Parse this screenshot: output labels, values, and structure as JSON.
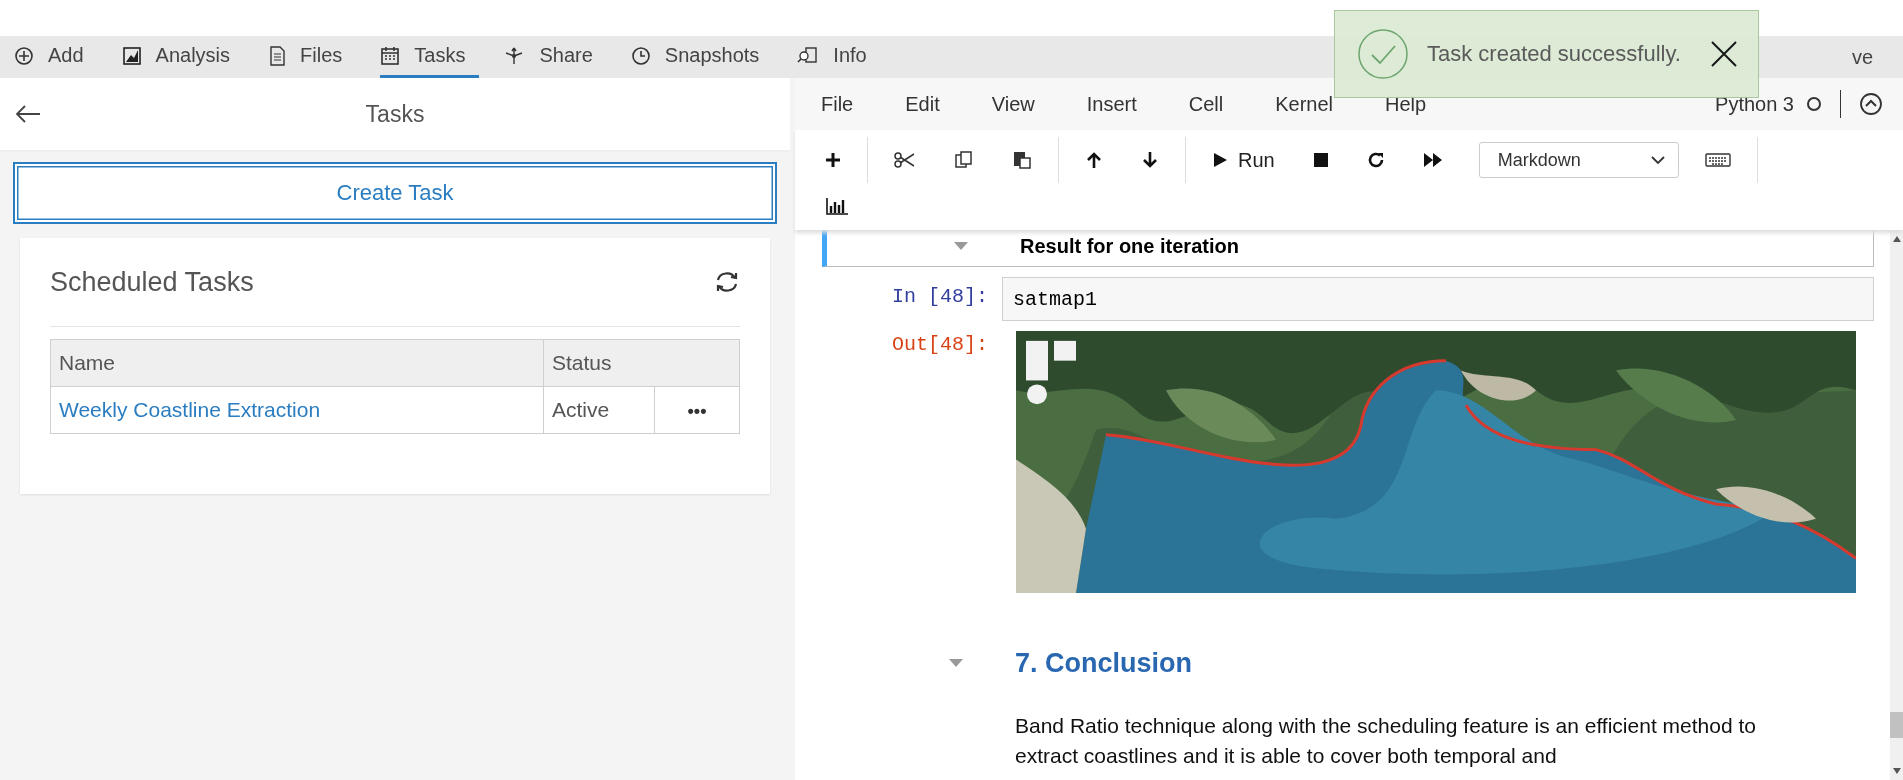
{
  "tabs": [
    {
      "label": "Add",
      "selected": false
    },
    {
      "label": "Analysis",
      "selected": false
    },
    {
      "label": "Files",
      "selected": false
    },
    {
      "label": "Tasks",
      "selected": true
    },
    {
      "label": "Share",
      "selected": false
    },
    {
      "label": "Snapshots",
      "selected": false
    },
    {
      "label": "Info",
      "selected": false
    }
  ],
  "tab_bar_end": {
    "label": "ve"
  },
  "toast": {
    "message": "Task created successfully."
  },
  "panel": {
    "title": "Tasks",
    "create_button": "Create Task",
    "card": {
      "title": "Scheduled Tasks",
      "columns": [
        "Name",
        "Status"
      ],
      "rows": [
        {
          "name": "Weekly Coastline Extraction",
          "status": "Active",
          "menu": "•••"
        }
      ]
    }
  },
  "notebook": {
    "menu": [
      "File",
      "Edit",
      "View",
      "Insert",
      "Cell",
      "Kernel",
      "Help"
    ],
    "kernel": "Python 3",
    "run_label": "Run",
    "cell_type": "Markdown",
    "cells": [
      {
        "kind": "heading",
        "text": "Result for one iteration",
        "selected": true
      },
      {
        "kind": "code",
        "prompt": "In [48]:",
        "code": "satmap1"
      },
      {
        "kind": "output",
        "prompt": "Out[48]:"
      },
      {
        "kind": "section",
        "text": "7. Conclusion"
      },
      {
        "kind": "paragraph",
        "text": "Band Ratio technique along with the scheduling feature is an efficient method to extract coastlines and it is able to cover both temporal and"
      }
    ]
  }
}
